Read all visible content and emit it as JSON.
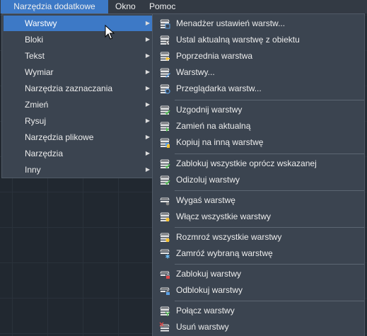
{
  "menubar": {
    "items": [
      {
        "label": "Narzędzia dodatkowe"
      },
      {
        "label": "Okno"
      },
      {
        "label": "Pomoc"
      }
    ]
  },
  "submenu_level1": {
    "items": [
      {
        "label": "Warstwy",
        "selected": true
      },
      {
        "label": "Bloki"
      },
      {
        "label": "Tekst"
      },
      {
        "label": "Wymiar"
      },
      {
        "label": "Narzędzia zaznaczania"
      },
      {
        "label": "Zmień"
      },
      {
        "label": "Rysuj"
      },
      {
        "label": "Narzędzia plikowe"
      },
      {
        "label": "Narzędzia"
      },
      {
        "label": "Inny"
      }
    ]
  },
  "submenu_level2": {
    "items": [
      {
        "label": "Menadżer ustawień warstw...",
        "icon": "layer-settings-manager-icon"
      },
      {
        "label": "Ustal aktualną warstwę z obiektu",
        "icon": "layer-from-object-icon"
      },
      {
        "label": "Poprzednia warstwa",
        "icon": "layer-previous-icon"
      },
      {
        "label": "Warstwy...",
        "icon": "layers-dialog-icon"
      },
      {
        "label": "Przeglądarka warstw...",
        "icon": "layer-browser-icon"
      },
      {
        "label": "Uzgodnij warstwy",
        "icon": "layer-reconcile-icon"
      },
      {
        "label": "Zamień na aktualną",
        "icon": "layer-change-current-icon"
      },
      {
        "label": "Kopiuj na inną warstwę",
        "icon": "layer-copy-icon"
      },
      {
        "label": "Zablokuj wszystkie oprócz wskazanej",
        "icon": "layer-lock-others-icon"
      },
      {
        "label": "Odizoluj warstwy",
        "icon": "layer-unisolate-icon"
      },
      {
        "label": "Wygaś warstwę",
        "icon": "layer-off-icon"
      },
      {
        "label": "Włącz wszystkie warstwy",
        "icon": "layer-on-all-icon"
      },
      {
        "label": "Rozmroź wszystkie warstwy",
        "icon": "layer-thaw-all-icon"
      },
      {
        "label": "Zamróź wybraną warstwę",
        "icon": "layer-freeze-icon"
      },
      {
        "label": "Zablokuj warstwy",
        "icon": "layer-lock-icon"
      },
      {
        "label": "Odblokuj warstwy",
        "icon": "layer-unlock-icon"
      },
      {
        "label": "Połącz warstwy",
        "icon": "layer-merge-icon"
      },
      {
        "label": "Usuń warstwy",
        "icon": "layer-delete-icon"
      }
    ]
  },
  "colors": {
    "highlight": "#3d79c6",
    "menu_bg": "#3b4450",
    "canvas_bg": "#212830"
  }
}
